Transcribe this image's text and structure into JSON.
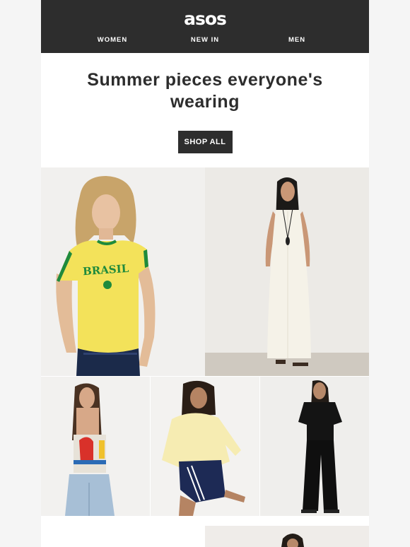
{
  "brand": {
    "logo_text": "asos",
    "colors": {
      "header_bg": "#2d2d2d",
      "page_bg": "#f5f5f5",
      "text": "#2d2d2d",
      "button_bg": "#2d2d2d",
      "button_text": "#ffffff"
    }
  },
  "nav": {
    "items": [
      {
        "label": "WOMEN"
      },
      {
        "label": "NEW IN"
      },
      {
        "label": "MEN"
      }
    ]
  },
  "hero": {
    "headline": "Summer pieces everyone's wearing",
    "cta_label": "SHOP ALL"
  },
  "products": [
    {
      "image": "model-yellow-brasil-tee",
      "printed_text": "BRASIL"
    },
    {
      "image": "model-white-maxi-jumpsuit"
    },
    {
      "image": "model-printed-bandeau-top"
    },
    {
      "image": "model-yellow-shirt-navy-shorts"
    },
    {
      "image": "model-black-tee-wide-trousers"
    },
    {
      "image": "model-partial-next-row"
    }
  ]
}
